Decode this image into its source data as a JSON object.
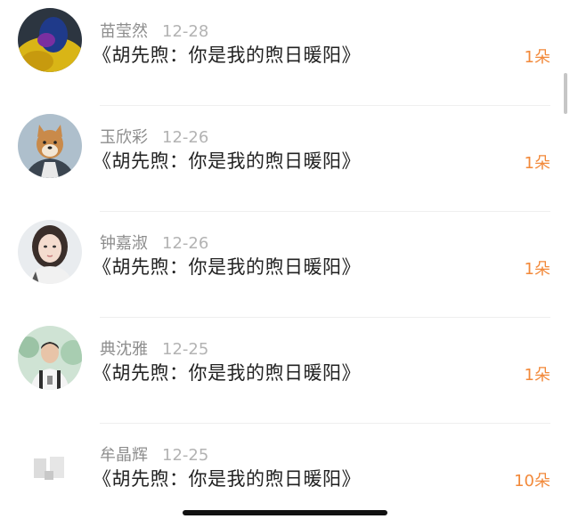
{
  "gifts": [
    {
      "name": "苗莹然",
      "date": "12-28",
      "title": "《胡先煦：你是我的煦日暖阳》",
      "count": "1朵",
      "avatar_icon": "blurry-yellow-figure-avatar"
    },
    {
      "name": "玉欣彩",
      "date": "12-26",
      "title": "《胡先煦：你是我的煦日暖阳》",
      "count": "1朵",
      "avatar_icon": "shiba-dog-avatar"
    },
    {
      "name": "钟嘉淑",
      "date": "12-26",
      "title": "《胡先煦：你是我的煦日暖阳》",
      "count": "1朵",
      "avatar_icon": "girl-portrait-avatar"
    },
    {
      "name": "典沈雅",
      "date": "12-25",
      "title": "《胡先煦：你是我的煦日暖阳》",
      "count": "1朵",
      "avatar_icon": "boy-outdoor-avatar"
    },
    {
      "name": "牟晶辉",
      "date": "12-25",
      "title": "《胡先煦：你是我的煦日暖阳》",
      "count": "10朵",
      "avatar_icon": "faded-white-avatar"
    }
  ],
  "colors": {
    "count_accent": "#f2893a",
    "name_gray": "#8d8d8d",
    "date_gray": "#b3b3b3",
    "title_dark": "#222222"
  }
}
